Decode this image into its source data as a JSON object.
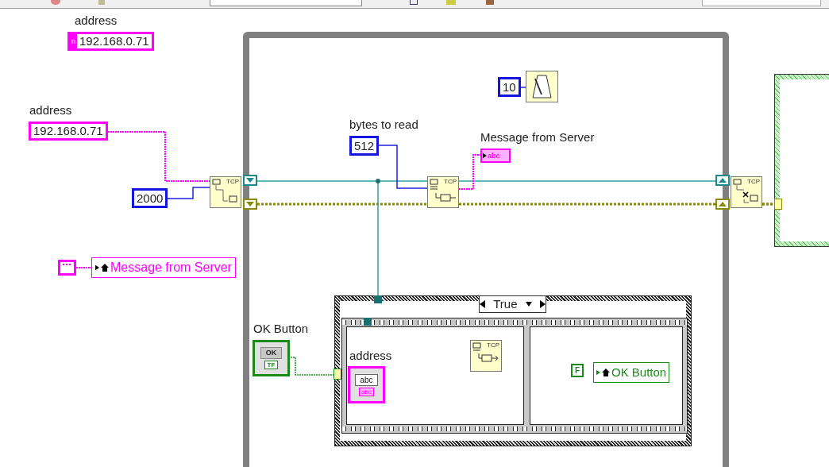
{
  "diagram": {
    "address_constant_top": {
      "label": "address",
      "prefix": "n",
      "value": "192.168.0.71"
    },
    "address_constant": {
      "label": "address",
      "value": "192.168.0.71"
    },
    "port_constant": {
      "value": "2000"
    },
    "message_local_variable": {
      "name": "Message from Server"
    },
    "wait_constant": {
      "value": "10"
    },
    "bytes_to_read": {
      "label": "bytes to read",
      "value": "512"
    },
    "message_indicator": {
      "label": "Message from Server",
      "type_text": "abc"
    },
    "tcp_nodes": [
      {
        "kind": "open",
        "text": "TCP"
      },
      {
        "kind": "read",
        "text": "TCP"
      },
      {
        "kind": "close",
        "text": "TCP"
      },
      {
        "kind": "write",
        "text": "TCP"
      }
    ],
    "case_structure": {
      "selector": "True",
      "ok_button": {
        "label": "OK Button",
        "button_text": "OK",
        "terminal_text": "TF"
      },
      "address_control": {
        "label": "address",
        "value": "abc",
        "terminal_text": "abc"
      },
      "false_constant": "F",
      "ok_local_variable": "OK Button"
    }
  }
}
